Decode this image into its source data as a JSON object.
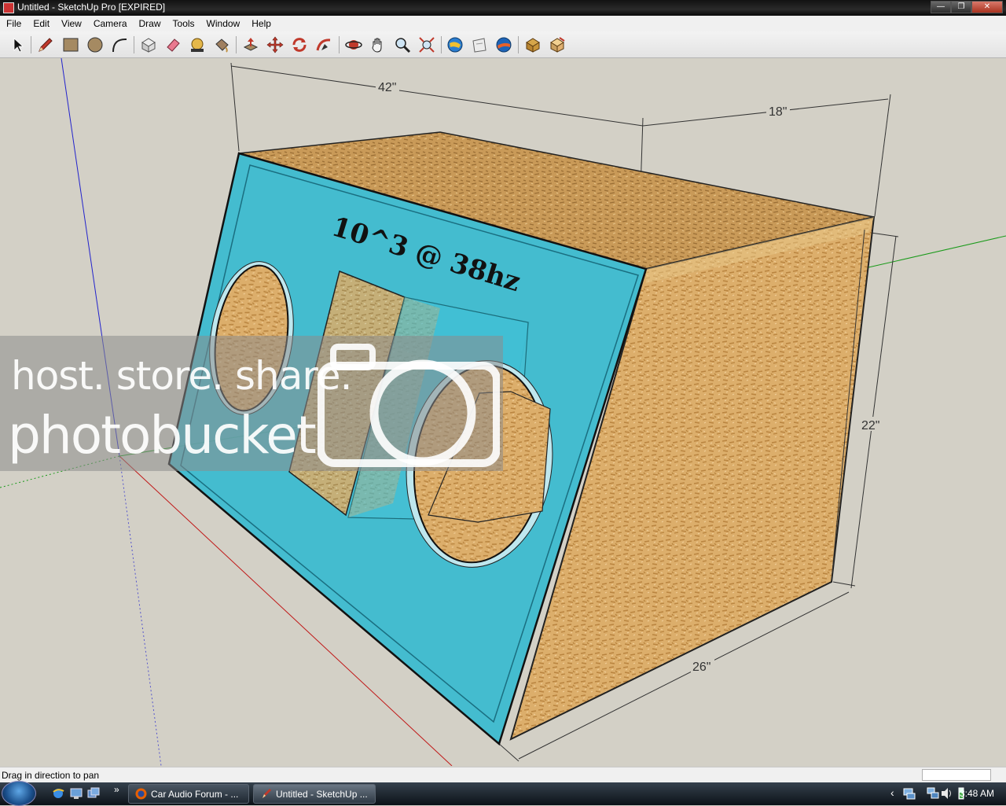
{
  "window": {
    "title": "Untitled - SketchUp Pro [EXPIRED]",
    "controls": {
      "minimize": "—",
      "maximize": "❐",
      "close": "✕"
    }
  },
  "menu": [
    "File",
    "Edit",
    "View",
    "Camera",
    "Draw",
    "Tools",
    "Window",
    "Help"
  ],
  "toolbar": {
    "tools": [
      "select-tool",
      "pencil-tool",
      "rectangle-tool",
      "circle-tool",
      "arc-tool",
      "make-component-tool",
      "eraser-tool",
      "tape-measure-tool",
      "paint-bucket-tool",
      "push-pull-tool",
      "move-tool",
      "rotate-tool",
      "follow-me-tool",
      "orbit-tool",
      "pan-tool",
      "zoom-tool",
      "zoom-extents-tool",
      "get-models-tool",
      "share-model-tool",
      "google-earth-tool",
      "components-tool",
      "styles-tool"
    ]
  },
  "model": {
    "front_text": "10^3 @ 38hz",
    "dimensions": {
      "width": "42\"",
      "depth": "18\"",
      "height": "22\"",
      "bottom_depth": "26\""
    },
    "colors": {
      "front_panel": "#30b8d0",
      "wood": "#d9ad6a",
      "background": "#d3d0c6"
    }
  },
  "watermark": {
    "line1": "host. store. share.",
    "line2": "photobucket"
  },
  "status": {
    "message": "Drag in direction to pan"
  },
  "taskbar": {
    "tasks": [
      {
        "label": "Car Audio Forum - ...",
        "active": false
      },
      {
        "label": "Untitled - SketchUp ...",
        "active": true
      }
    ],
    "tray_arrow": "‹",
    "clock": "3:48 AM"
  }
}
